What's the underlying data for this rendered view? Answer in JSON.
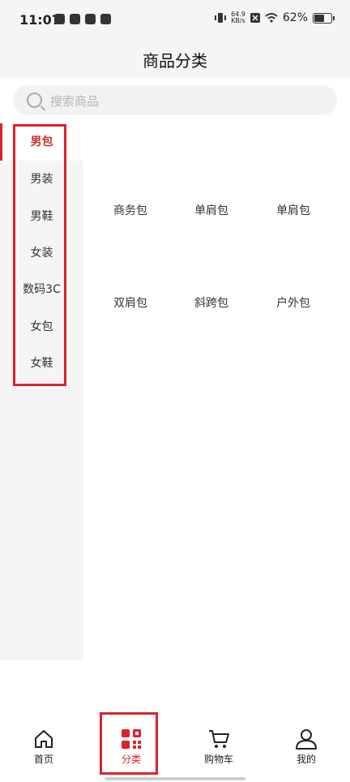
{
  "status_bar": {
    "time": "11:07",
    "speed_value": "64.9",
    "speed_unit": "KB/s",
    "battery": "62%"
  },
  "header": {
    "title": "商品分类"
  },
  "search": {
    "placeholder": "搜索商品"
  },
  "sidebar": {
    "items": [
      {
        "label": "男包",
        "active": true
      },
      {
        "label": "男装"
      },
      {
        "label": "男鞋"
      },
      {
        "label": "女装"
      },
      {
        "label": "数码3C"
      },
      {
        "label": "女包"
      },
      {
        "label": "女鞋"
      }
    ]
  },
  "content": {
    "categories": [
      "商务包",
      "单肩包",
      "单肩包",
      "双肩包",
      "斜跨包",
      "户外包"
    ]
  },
  "tabbar": {
    "tabs": [
      {
        "label": "首页",
        "icon": "home-icon"
      },
      {
        "label": "分类",
        "icon": "category-icon",
        "active": true
      },
      {
        "label": "购物车",
        "icon": "cart-icon"
      },
      {
        "label": "我的",
        "icon": "user-icon"
      }
    ]
  },
  "colors": {
    "accent": "#d9232d",
    "sidebar_bg": "#f5f5f5"
  }
}
